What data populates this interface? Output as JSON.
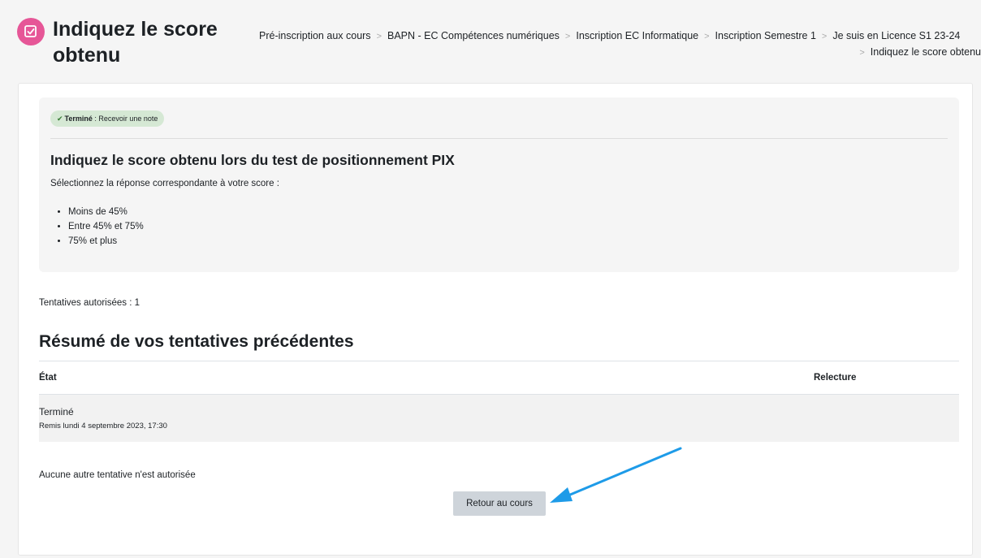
{
  "header": {
    "title": "Indiquez le score obtenu",
    "icon": "quiz-icon",
    "icon_color": "#e65697"
  },
  "breadcrumb": {
    "row1": [
      "Pré-inscription aux cours",
      "BAPN - EC Compétences numériques",
      "Inscription EC Informatique",
      "Inscription Semestre 1",
      "Je suis en Licence S1 23-24"
    ],
    "row2": [
      "Indiquez le score obtenu"
    ]
  },
  "completion": {
    "status": "Terminé",
    "detail": " : Recevoir une note"
  },
  "quiz": {
    "heading": "Indiquez le score obtenu lors du test de positionnement PIX",
    "intro": "Sélectionnez la réponse correspondante à votre score :",
    "options": [
      "Moins de 45%",
      "Entre 45% et 75%",
      "75% et plus"
    ]
  },
  "attempts_allowed": "Tentatives autorisées : 1",
  "summary": {
    "title": "Résumé de vos tentatives précédentes",
    "columns": [
      "État",
      "Relecture"
    ],
    "rows": [
      {
        "state": "Terminé",
        "submitted": "Remis lundi 4 septembre 2023, 17:30"
      }
    ]
  },
  "no_more_attempts": "Aucune autre tentative n'est autorisée",
  "back_button_label": "Retour au cours",
  "annotation": {
    "arrow_color": "#1e9be8"
  }
}
